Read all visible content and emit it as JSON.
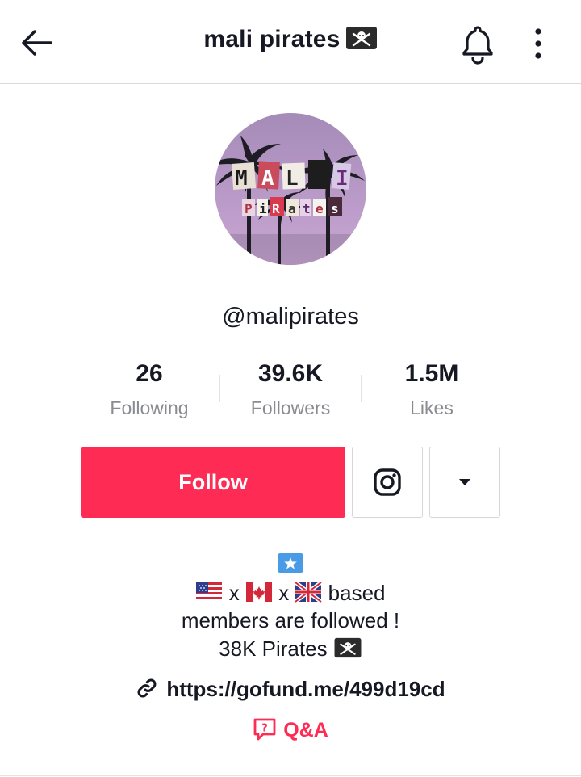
{
  "header": {
    "title": "mali pirates",
    "title_flag_icon": "pirate-flag-icon",
    "back_icon": "arrow-left-icon",
    "bell_icon": "bell-icon",
    "more_icon": "vertical-dots-icon"
  },
  "profile": {
    "avatar_text_top": "MALI",
    "avatar_text_bottom": "Pirates",
    "username": "@malipirates"
  },
  "stats": [
    {
      "value": "26",
      "label": "Following"
    },
    {
      "value": "39.6K",
      "label": "Followers"
    },
    {
      "value": "1.5M",
      "label": "Likes"
    }
  ],
  "actions": {
    "follow_label": "Follow",
    "instagram_icon": "instagram-icon",
    "dropdown_icon": "caret-down-icon"
  },
  "bio": {
    "line1_flag": "somalia-flag-icon",
    "line2_sep": "x",
    "line2_text": "based",
    "line3": "members are followed !",
    "line4": "38K Pirates"
  },
  "link": {
    "url": "https://gofund.me/499d19cd"
  },
  "qa": {
    "label": "Q&A"
  },
  "colors": {
    "accent": "#fe2c55",
    "text": "#161823",
    "muted": "#8a8b91"
  }
}
